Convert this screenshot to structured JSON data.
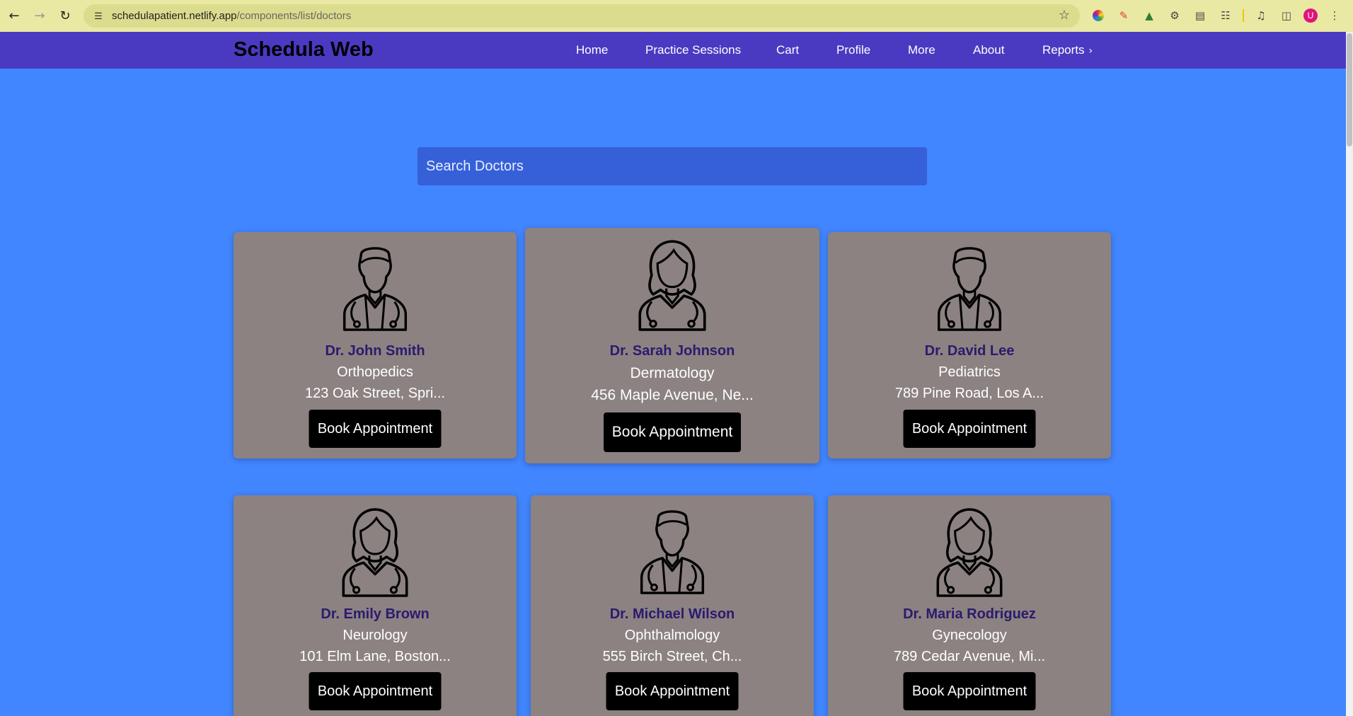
{
  "browser": {
    "url_host": "schedulapatient.netlify.app",
    "url_path": "/components/list/doctors",
    "profile_initial": "U"
  },
  "header": {
    "brand": "Schedula Web",
    "nav": [
      {
        "label": "Home"
      },
      {
        "label": "Practice Sessions"
      },
      {
        "label": "Cart"
      },
      {
        "label": "Profile"
      },
      {
        "label": "More"
      },
      {
        "label": "About"
      },
      {
        "label": "Reports"
      }
    ]
  },
  "search": {
    "placeholder": "Search Doctors"
  },
  "doctors": [
    {
      "name": "Dr. John Smith",
      "specialty": "Orthopedics",
      "address": "123 Oak Street, Spri...",
      "button": "Book Appointment",
      "avatar": "male-doctor-icon"
    },
    {
      "name": "Dr. Sarah Johnson",
      "specialty": "Dermatology",
      "address": "456 Maple Avenue, Ne...",
      "button": "Book Appointment",
      "avatar": "female-doctor-icon"
    },
    {
      "name": "Dr. David Lee",
      "specialty": "Pediatrics",
      "address": "789 Pine Road, Los A...",
      "button": "Book Appointment",
      "avatar": "male-doctor-icon"
    },
    {
      "name": "Dr. Emily Brown",
      "specialty": "Neurology",
      "address": "101 Elm Lane, Boston...",
      "button": "Book Appointment",
      "avatar": "female-doctor-icon"
    },
    {
      "name": "Dr. Michael Wilson",
      "specialty": "Ophthalmology",
      "address": "555 Birch Street, Ch...",
      "button": "Book Appointment",
      "avatar": "male-doctor-icon"
    },
    {
      "name": "Dr. Maria Rodriguez",
      "specialty": "Gynecology",
      "address": "789 Cedar Avenue, Mi...",
      "button": "Book Appointment",
      "avatar": "female-doctor-icon"
    }
  ],
  "colors": {
    "page_bg": "#4185ff",
    "appbar_bg": "#4a3ac2",
    "card_bg": "#8c8282",
    "name_color": "#2a1b6e",
    "button_bg": "#000000"
  }
}
